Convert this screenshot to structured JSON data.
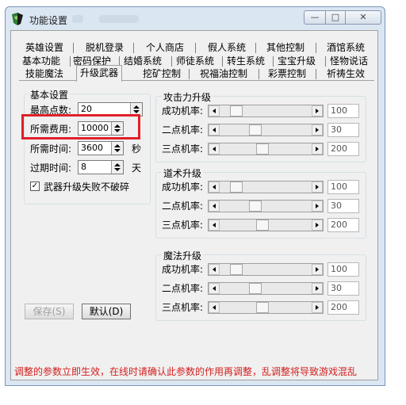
{
  "window": {
    "title": "功能设置",
    "min": "—",
    "max": "□",
    "close": "✕"
  },
  "tabs": {
    "row1": [
      "英雄设置",
      "脱机登录",
      "个人商店",
      "假人系统",
      "其他控制",
      "酒馆系统"
    ],
    "row2": [
      "基本功能",
      "密码保护",
      "结婚系统",
      "师徒系统",
      "转生系统",
      "宝宝升级",
      "怪物说话"
    ],
    "row3": [
      "技能魔法",
      "升级武器",
      "挖矿控制",
      "祝福油控制",
      "彩票控制",
      "祈祷生效"
    ],
    "active": "升级武器"
  },
  "basic": {
    "title": "基本设置",
    "max_points_label": "最高点数:",
    "max_points": "20",
    "cost_label": "所需费用:",
    "cost": "10000",
    "time_label": "所需时间:",
    "time": "3600",
    "time_unit": "秒",
    "expire_label": "过期时间:",
    "expire": "8",
    "expire_unit": "天",
    "nobreak_label": "武器升级失败不破碎",
    "nobreak_checked": "✓"
  },
  "attack": {
    "title": "攻击力升级",
    "rows": [
      {
        "label": "成功机率:",
        "value": "100",
        "level": 0.13
      },
      {
        "label": "二点机率:",
        "value": "30",
        "level": 0.36
      },
      {
        "label": "三点机率:",
        "value": "200",
        "level": 0.45
      }
    ]
  },
  "tao": {
    "title": "道术升级",
    "rows": [
      {
        "label": "成功机率:",
        "value": "100",
        "level": 0.13
      },
      {
        "label": "二点机率:",
        "value": "30",
        "level": 0.36
      },
      {
        "label": "三点机率:",
        "value": "200",
        "level": 0.45
      }
    ]
  },
  "magic": {
    "title": "魔法升级",
    "rows": [
      {
        "label": "成功机率:",
        "value": "100",
        "level": 0.13
      },
      {
        "label": "二点机率:",
        "value": "30",
        "level": 0.36
      },
      {
        "label": "三点机率:",
        "value": "200",
        "level": 0.45
      }
    ]
  },
  "buttons": {
    "save": "保存(S)",
    "default": "默认(D)"
  },
  "warning": "调整的参数立即生效，在线时请确认此参数的作用再调整，乱调整将导致游戏混乱",
  "colors": {
    "highlight": "#e0202a",
    "warning": "#d42020"
  }
}
